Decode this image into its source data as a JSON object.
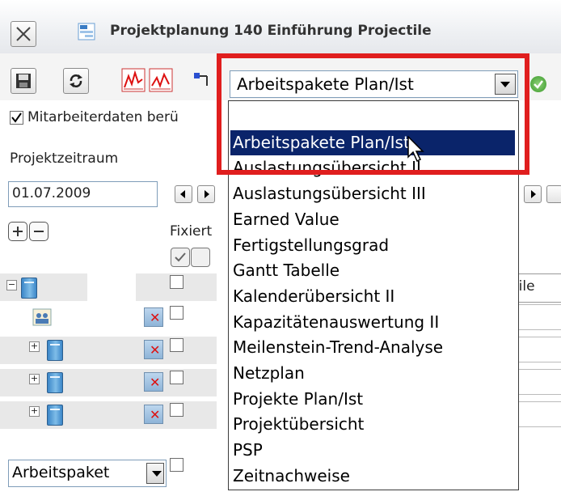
{
  "window": {
    "title": "Projektplanung 140 Einführung Projectile"
  },
  "toolbar": {
    "combo_value": "Arbeitspakete Plan/Ist",
    "icons": [
      "close-icon",
      "window-icon",
      "save-icon",
      "refresh-icon",
      "chart-red-icon",
      "chart-red2-icon",
      "connector-icon",
      "dropdown-arrow-icon",
      "ok-icon"
    ]
  },
  "filters": {
    "checkbox_label": "Mitarbeiterdaten berü",
    "checkbox_checked": true,
    "period_label": "Projektzeitraum",
    "date_value": "01.07.2009"
  },
  "grid": {
    "fixed_header": "Fixiert",
    "column_fragment": "tile",
    "footer_select": "Arbeitspaket"
  },
  "dropdown": {
    "selected_index": 1,
    "options": [
      "",
      "Arbeitspakete Plan/Ist",
      "Auslastungsübersicht II",
      "Auslastungsübersicht III",
      "Earned Value",
      "Fertigstellungsgrad",
      "Gantt Tabelle",
      "Kalenderübersicht II",
      "Kapazitätenauswertung II",
      "Meilenstein-Trend-Analyse",
      "Netzplan",
      "Projekte Plan/Ist",
      "Projektübersicht",
      "PSP",
      "Zeitnachweise"
    ]
  },
  "colors": {
    "highlight": "#e01e1e",
    "selection": "#0a246a"
  }
}
